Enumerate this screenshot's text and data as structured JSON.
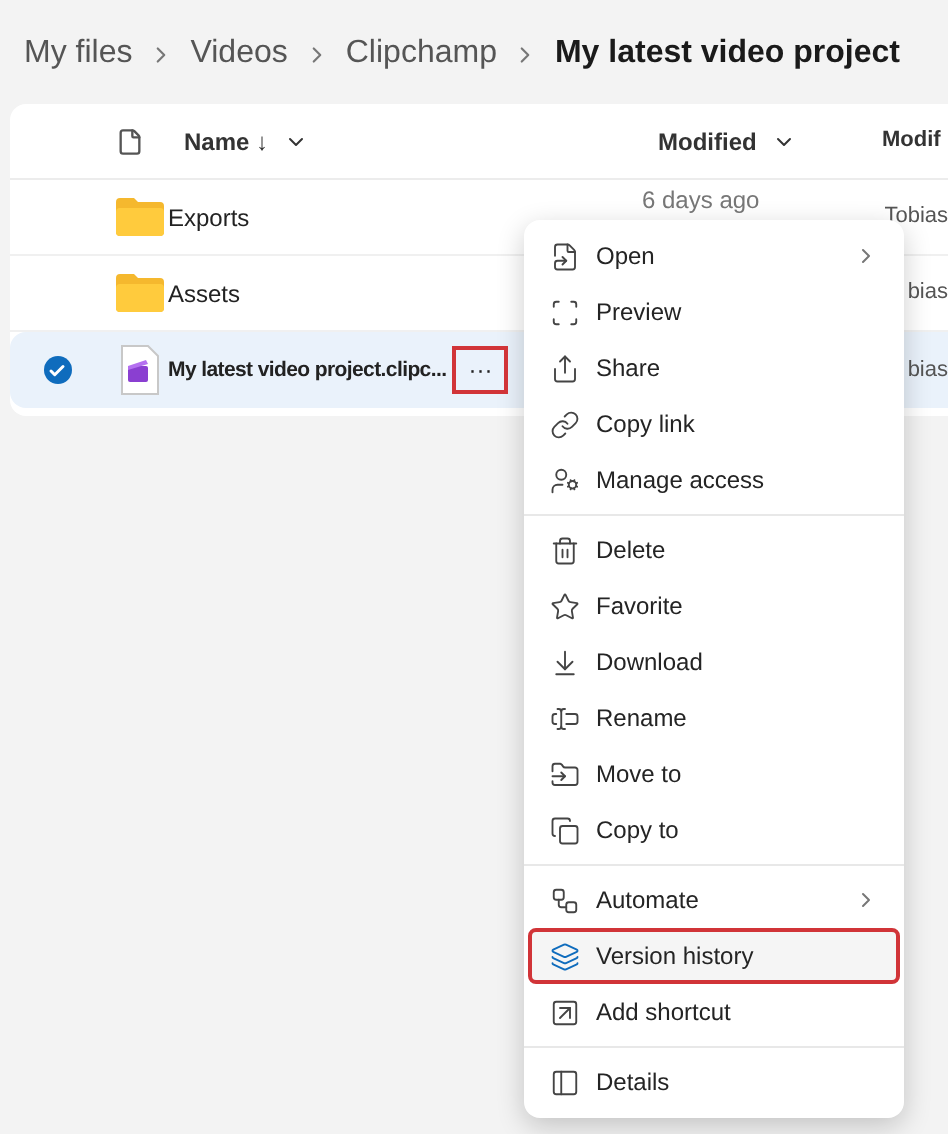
{
  "breadcrumbs": [
    {
      "label": "My files",
      "current": false
    },
    {
      "label": "Videos",
      "current": false
    },
    {
      "label": "Clipchamp",
      "current": false
    },
    {
      "label": "My latest video project",
      "current": true
    }
  ],
  "table": {
    "columns": [
      "Name ↓",
      "Modified",
      "Modif"
    ],
    "rows": [
      {
        "kind": "folder",
        "name": "Exports",
        "modified": "6 days ago",
        "modified_by": "Tobias",
        "selected": false
      },
      {
        "kind": "folder",
        "name": "Assets",
        "modified": "",
        "modified_by": "bias",
        "selected": false
      },
      {
        "kind": "clipchamp",
        "name": "My latest video project.clipc...",
        "modified": "",
        "modified_by": "bias",
        "selected": true,
        "more_highlighted": true
      }
    ]
  },
  "more_button": "···",
  "context_menu": {
    "groups": [
      [
        {
          "label": "Open",
          "submenu": true,
          "highlighted": false
        },
        {
          "label": "Preview",
          "submenu": false,
          "highlighted": false
        },
        {
          "label": "Share",
          "submenu": false,
          "highlighted": false
        },
        {
          "label": "Copy link",
          "submenu": false,
          "highlighted": false
        },
        {
          "label": "Manage access",
          "submenu": false,
          "highlighted": false
        }
      ],
      [
        {
          "label": "Delete",
          "submenu": false,
          "highlighted": false
        },
        {
          "label": "Favorite",
          "submenu": false,
          "highlighted": false
        },
        {
          "label": "Download",
          "submenu": false,
          "highlighted": false
        },
        {
          "label": "Rename",
          "submenu": false,
          "highlighted": false
        },
        {
          "label": "Move to",
          "submenu": false,
          "highlighted": false
        },
        {
          "label": "Copy to",
          "submenu": false,
          "highlighted": false
        }
      ],
      [
        {
          "label": "Automate",
          "submenu": true,
          "highlighted": false
        },
        {
          "label": "Version history",
          "submenu": false,
          "highlighted": true
        },
        {
          "label": "Add shortcut",
          "submenu": false,
          "highlighted": false
        }
      ],
      [
        {
          "label": "Details",
          "submenu": false,
          "highlighted": false
        }
      ]
    ]
  }
}
